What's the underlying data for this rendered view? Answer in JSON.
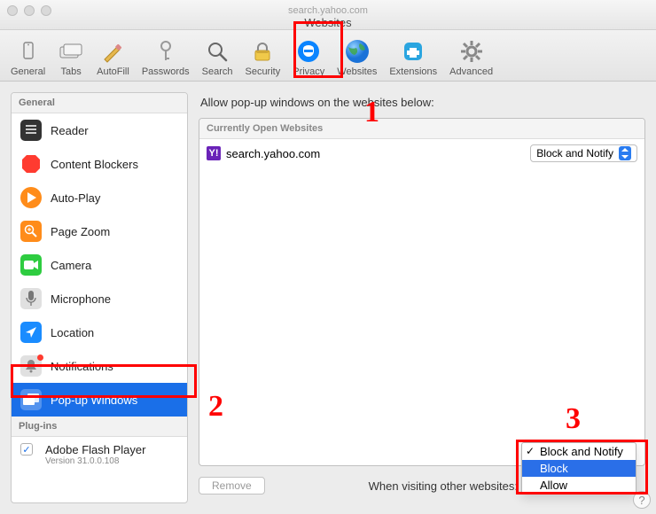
{
  "window": {
    "tab_title": "search.yahoo.com",
    "title": "Websites"
  },
  "toolbar": [
    {
      "id": "general",
      "label": "General"
    },
    {
      "id": "tabs",
      "label": "Tabs"
    },
    {
      "id": "autofill",
      "label": "AutoFill"
    },
    {
      "id": "passwords",
      "label": "Passwords"
    },
    {
      "id": "search",
      "label": "Search"
    },
    {
      "id": "security",
      "label": "Security"
    },
    {
      "id": "privacy",
      "label": "Privacy"
    },
    {
      "id": "websites",
      "label": "Websites",
      "active": true
    },
    {
      "id": "extensions",
      "label": "Extensions"
    },
    {
      "id": "advanced",
      "label": "Advanced"
    }
  ],
  "sidebar": {
    "general_header": "General",
    "items": [
      {
        "id": "reader",
        "label": "Reader"
      },
      {
        "id": "blockers",
        "label": "Content Blockers"
      },
      {
        "id": "autoplay",
        "label": "Auto-Play"
      },
      {
        "id": "zoom",
        "label": "Page Zoom"
      },
      {
        "id": "camera",
        "label": "Camera"
      },
      {
        "id": "mic",
        "label": "Microphone"
      },
      {
        "id": "location",
        "label": "Location"
      },
      {
        "id": "notif",
        "label": "Notifications"
      },
      {
        "id": "popups",
        "label": "Pop-up Windows",
        "selected": true
      }
    ],
    "plugins_header": "Plug-ins",
    "plugin": {
      "name": "Adobe Flash Player",
      "version": "Version 31.0.0.108",
      "enabled": true
    }
  },
  "main": {
    "title": "Allow pop-up windows on the websites below:",
    "panel_header": "Currently Open Websites",
    "rows": [
      {
        "site": "search.yahoo.com",
        "value": "Block and Notify"
      }
    ],
    "remove_label": "Remove",
    "footer_label": "When visiting other websites:"
  },
  "dropdown": {
    "items": [
      {
        "label": "Block and Notify",
        "checked": true
      },
      {
        "label": "Block",
        "selected": true
      },
      {
        "label": "Allow"
      }
    ]
  },
  "annotations": {
    "n1": "1",
    "n2": "2",
    "n3": "3"
  }
}
